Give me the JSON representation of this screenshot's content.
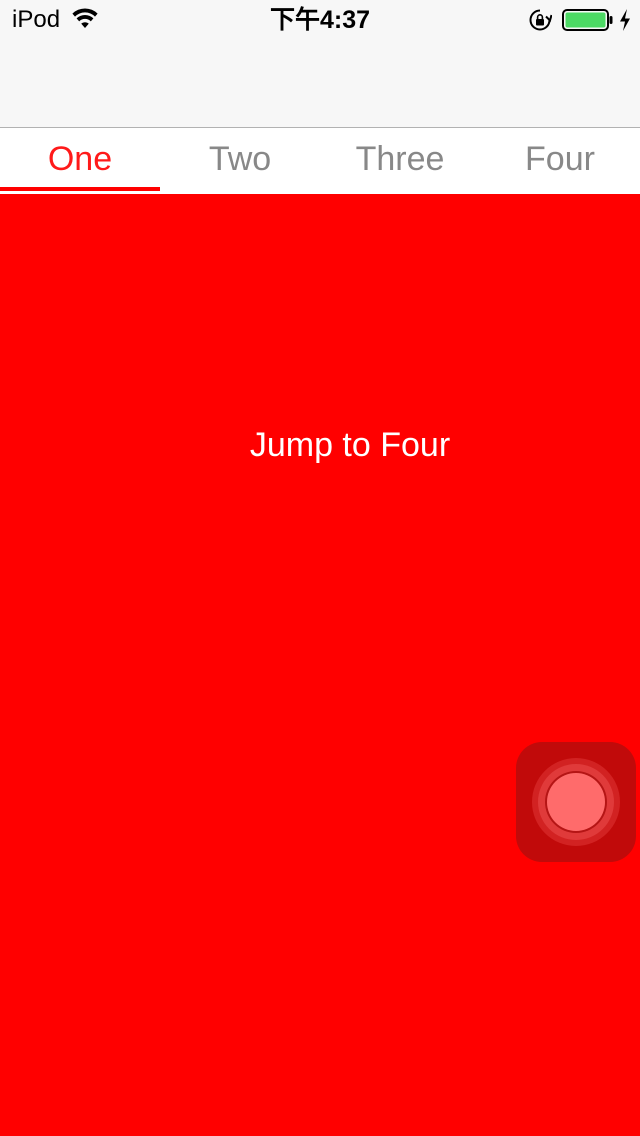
{
  "status_bar": {
    "carrier": "iPod",
    "time": "下午4:37",
    "battery_color": "#4cd964",
    "icons": [
      "wifi-icon",
      "lock-rotation-icon",
      "battery-icon",
      "charging-icon"
    ]
  },
  "tabs": {
    "items": [
      {
        "label": "One",
        "active": true
      },
      {
        "label": "Two",
        "active": false
      },
      {
        "label": "Three",
        "active": false
      },
      {
        "label": "Four",
        "active": false
      }
    ],
    "active_color": "#ff1a1a",
    "inactive_color": "#888888"
  },
  "page": {
    "background": "#ff0000",
    "jump_button_label": "Jump to Four"
  },
  "assistive_touch": {
    "icon": "assistive-touch-icon"
  }
}
